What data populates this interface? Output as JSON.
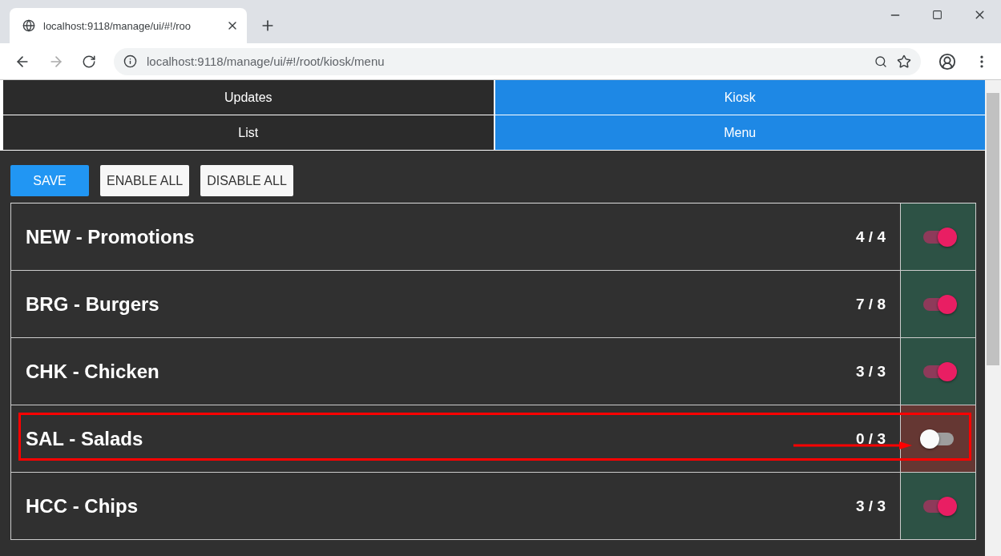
{
  "browser": {
    "tab_title": "localhost:9118/manage/ui/#!/roo",
    "address": "localhost:9118/manage/ui/#!/root/kiosk/menu"
  },
  "nav_rows": [
    [
      {
        "label": "Updates",
        "selected": false
      },
      {
        "label": "Kiosk",
        "selected": true
      }
    ],
    [
      {
        "label": "List",
        "selected": false
      },
      {
        "label": "Menu",
        "selected": true
      }
    ]
  ],
  "actions": [
    {
      "label": "SAVE",
      "kind": "primary"
    },
    {
      "label": "ENABLE ALL",
      "kind": "plain"
    },
    {
      "label": "DISABLE ALL",
      "kind": "plain"
    }
  ],
  "categories": [
    {
      "name": "NEW - Promotions",
      "count": "4 / 4",
      "on": true,
      "highlighted": false
    },
    {
      "name": "BRG - Burgers",
      "count": "7 / 8",
      "on": true,
      "highlighted": false
    },
    {
      "name": "CHK - Chicken",
      "count": "3 / 3",
      "on": true,
      "highlighted": false
    },
    {
      "name": "SAL - Salads",
      "count": "0 / 3",
      "on": false,
      "highlighted": true
    },
    {
      "name": "HCC - Chips",
      "count": "3 / 3",
      "on": true,
      "highlighted": false
    }
  ]
}
